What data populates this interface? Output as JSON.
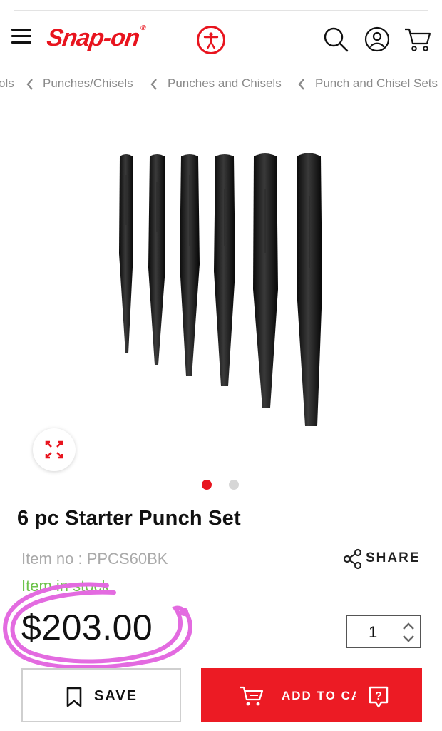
{
  "header": {
    "brand": "Snap-on",
    "brand_mark": "®"
  },
  "breadcrumb": [
    "ols",
    "Punches/Chisels",
    "Punches and Chisels",
    "Punch and Chisel Sets"
  ],
  "gallery": {
    "total_slides": 2,
    "active_slide": 1
  },
  "product": {
    "title": "6 pc Starter Punch Set",
    "item_no": "Item no : PPCS60BK",
    "stock": "Item in stock",
    "price": "$203.00",
    "quantity": "1"
  },
  "actions": {
    "share_label": "SHARE",
    "save_label": "SAVE",
    "add_to_cart_label": "ADD TO CART"
  },
  "colors": {
    "brand_red": "#e8141e",
    "stock_green": "#6cc24a",
    "annotation_pink": "#e36be0"
  },
  "icons": [
    "menu-icon",
    "accessibility-icon",
    "search-icon",
    "account-icon",
    "cart-icon",
    "chevron-left-icon",
    "fullscreen-icon",
    "share-icon",
    "bookmark-icon",
    "help-icon"
  ]
}
